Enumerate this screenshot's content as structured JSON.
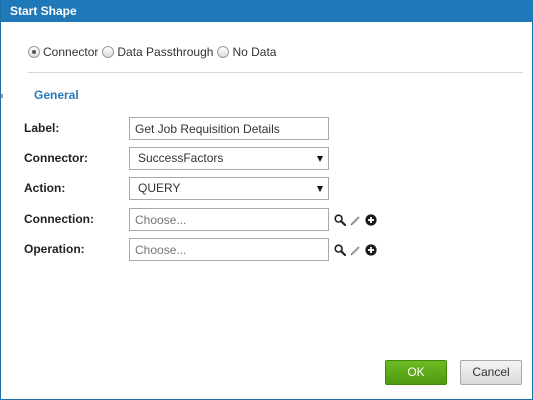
{
  "window": {
    "title": "Start Shape"
  },
  "source_options": [
    {
      "label": "Connector",
      "checked": true
    },
    {
      "label": "Data Passthrough",
      "checked": false
    },
    {
      "label": "No Data",
      "checked": false
    }
  ],
  "section": {
    "title": "General"
  },
  "form": {
    "label": {
      "caption": "Label:",
      "value": "Get Job Requisition Details"
    },
    "connector": {
      "caption": "Connector:",
      "value": "SuccessFactors"
    },
    "action": {
      "caption": "Action:",
      "value": "QUERY"
    },
    "connection": {
      "caption": "Connection:",
      "placeholder": "Choose..."
    },
    "operation": {
      "caption": "Operation:",
      "placeholder": "Choose..."
    }
  },
  "icons": {
    "search": "magnifier-icon",
    "edit": "pencil-icon",
    "add": "plus-circle-icon"
  },
  "buttons": {
    "ok": "OK",
    "cancel": "Cancel"
  },
  "colors": {
    "titlebar": "#1f78b8",
    "section_title": "#2a7ab5",
    "ok_button": "#5aaa18"
  }
}
